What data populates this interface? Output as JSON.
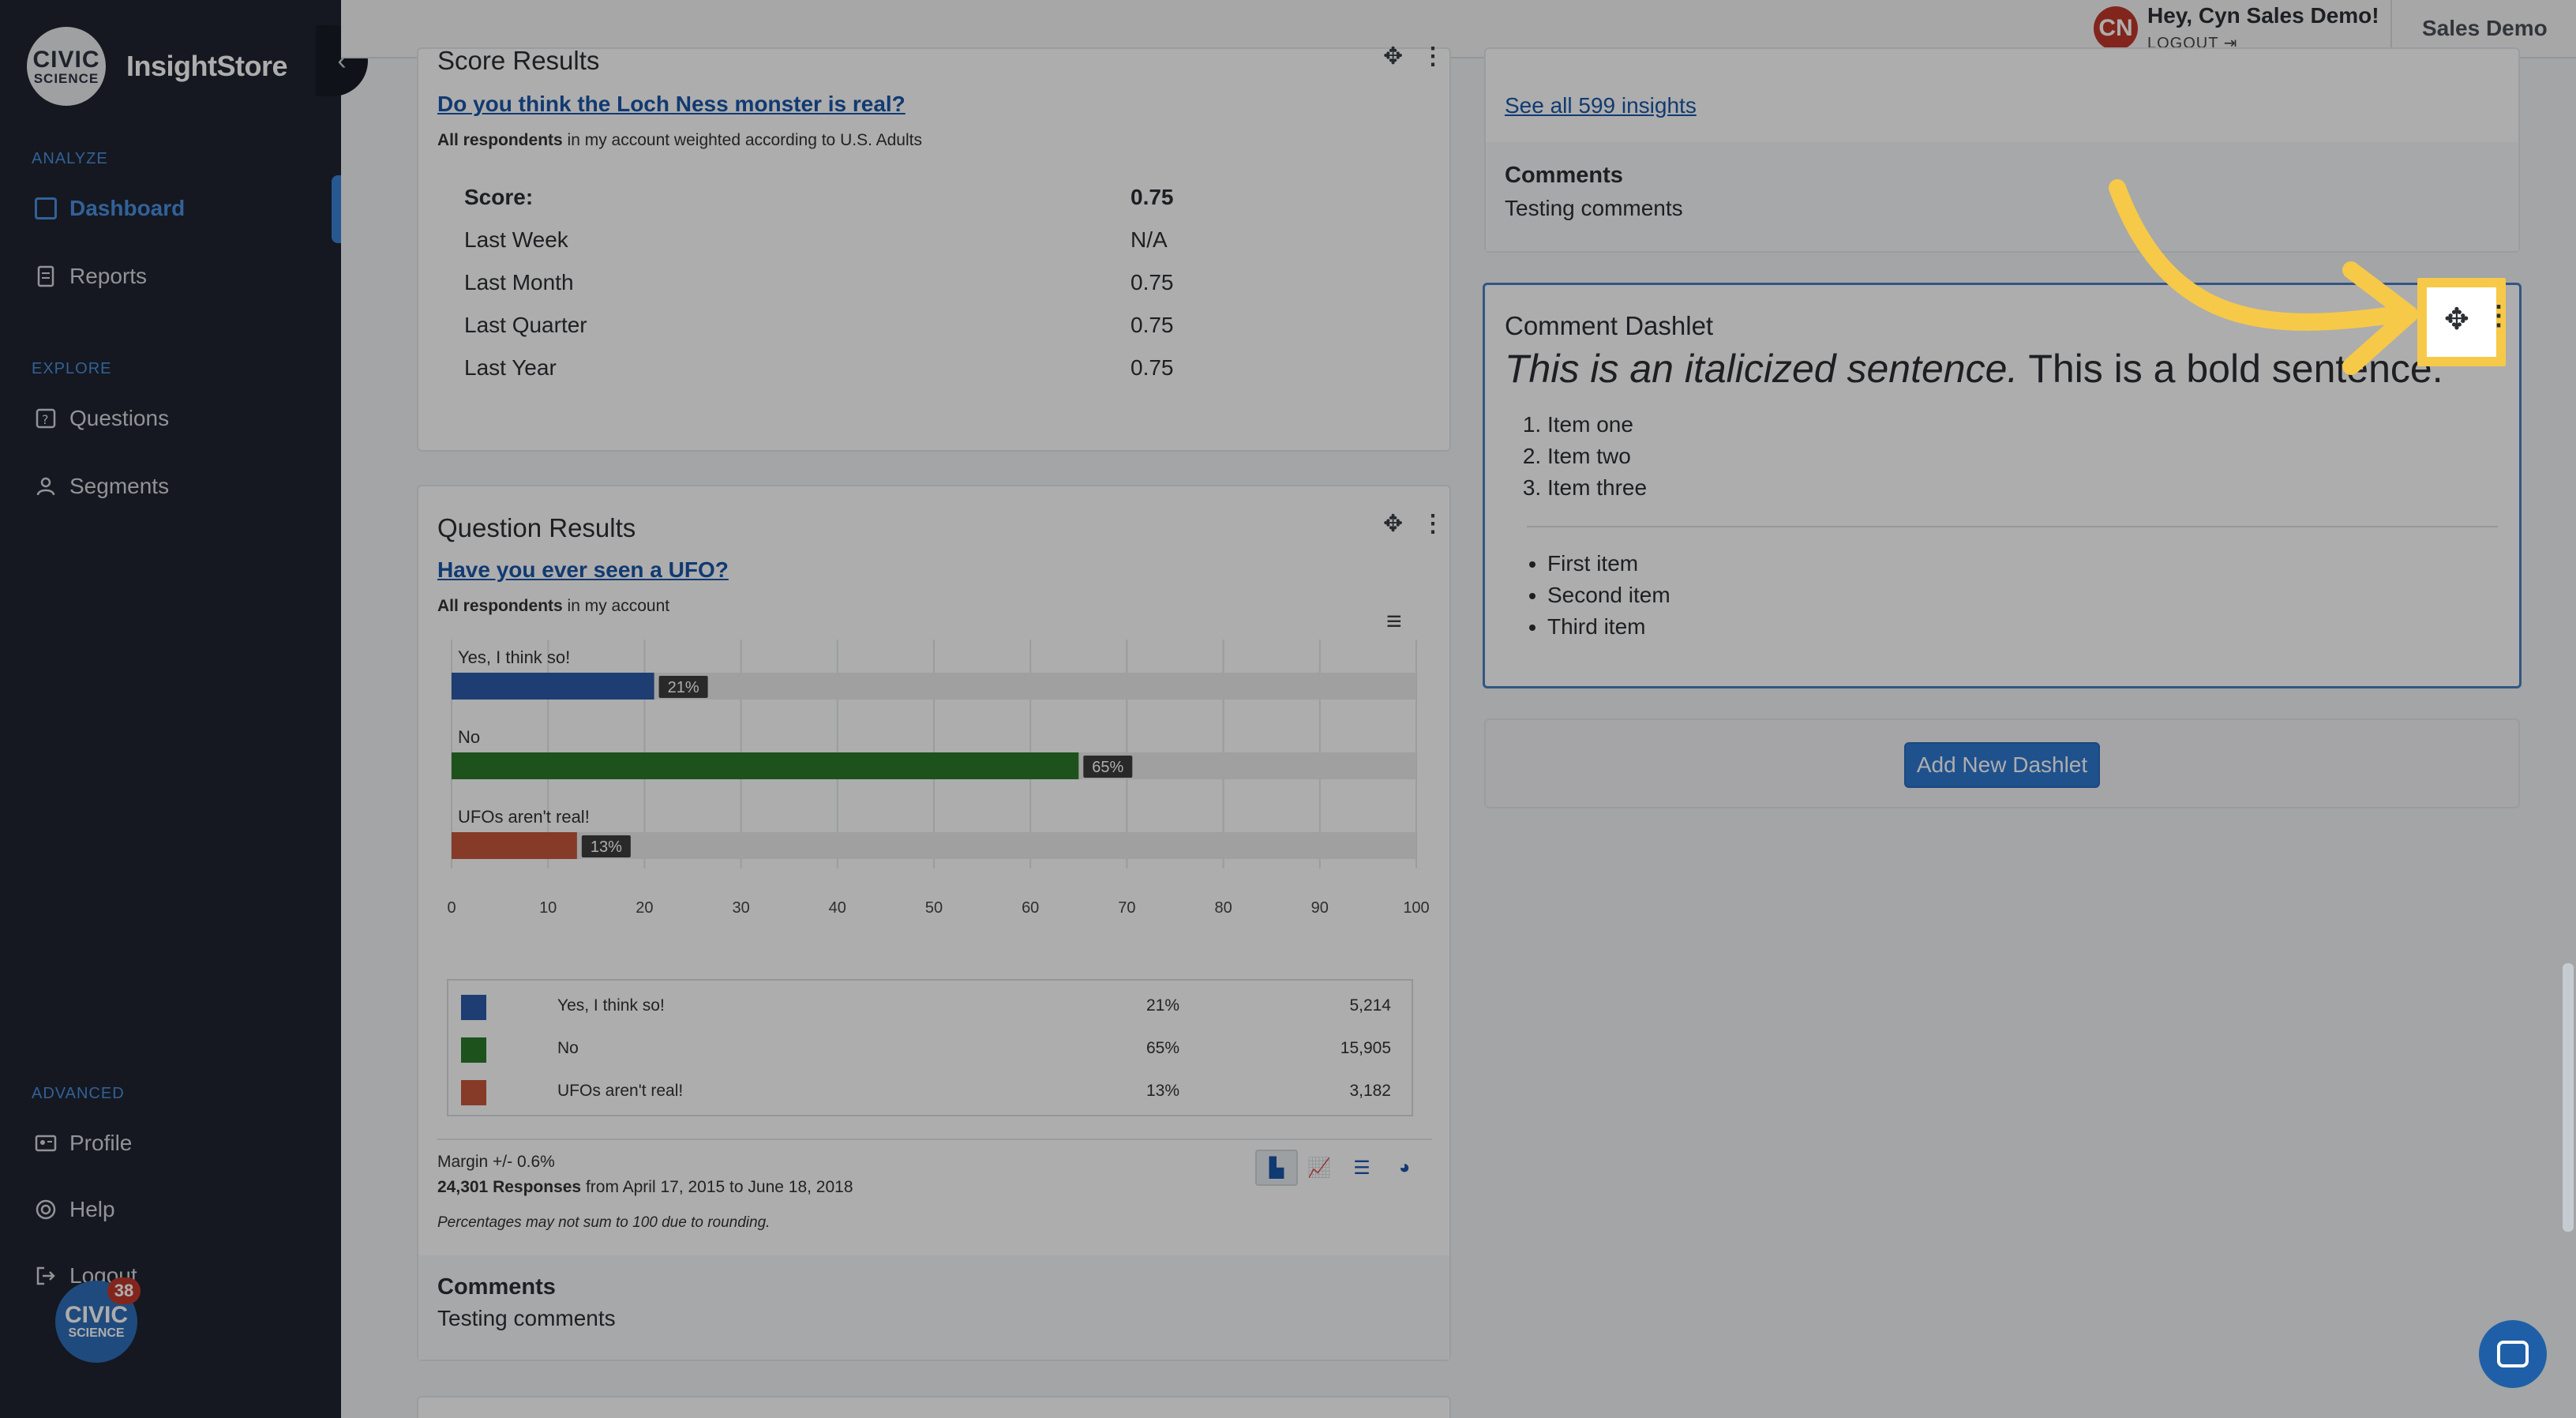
{
  "sidebar": {
    "logo": {
      "line1": "CIVIC",
      "line2": "SCIENCE"
    },
    "brand": "InsightStore",
    "collapse_icon": "chevron-left-icon",
    "sections": {
      "analyze": "ANALYZE",
      "explore": "EXPLORE",
      "advanced": "ADVANCED"
    },
    "items": [
      {
        "label": "Dashboard",
        "icon": "dashboard-icon"
      },
      {
        "label": "Reports",
        "icon": "document-icon"
      },
      {
        "label": "Questions",
        "icon": "question-icon"
      },
      {
        "label": "Segments",
        "icon": "users-icon"
      },
      {
        "label": "Profile",
        "icon": "id-card-icon"
      },
      {
        "label": "Help",
        "icon": "lifebuoy-icon"
      },
      {
        "label": "Logout",
        "icon": "logout-icon"
      }
    ],
    "fab": {
      "line1": "CIVIC",
      "line2": "SCIENCE",
      "badge": "38"
    }
  },
  "topbar": {
    "avatar_initials": "CN",
    "greeting": "Hey, Cyn Sales Demo!",
    "logout": "LOGOUT",
    "org": "Sales Demo"
  },
  "score_card": {
    "title": "Score Results",
    "question": "Do you think the Loch Ness monster is real?",
    "respondents_bold": "All respondents",
    "respondents_rest": " in my account weighted according to U.S. Adults",
    "rows": [
      {
        "label": "Score:",
        "value": "0.75"
      },
      {
        "label": "Last Week",
        "value": "N/A"
      },
      {
        "label": "Last Month",
        "value": "0.75"
      },
      {
        "label": "Last Quarter",
        "value": "0.75"
      },
      {
        "label": "Last Year",
        "value": "0.75"
      }
    ]
  },
  "question_card": {
    "title": "Question Results",
    "question": "Have you ever seen a UFO?",
    "respondents_bold": "All respondents",
    "respondents_rest": " in my account",
    "legend": [
      {
        "label": "Yes, I think so!",
        "pct": "21%",
        "count": "5,214"
      },
      {
        "label": "No",
        "pct": "65%",
        "count": "15,905"
      },
      {
        "label": "UFOs aren't real!",
        "pct": "13%",
        "count": "3,182"
      }
    ],
    "margin": "Margin +/- 0.6%",
    "responses_bold": "24,301 Responses",
    "responses_rest": " from April 17, 2015 to June 18, 2018",
    "note": "Percentages may not sum to 100 due to rounding.",
    "view_icons": [
      "bar-chart-icon",
      "line-chart-icon",
      "stacked-bar-icon",
      "pie-chart-icon"
    ],
    "comments_title": "Comments",
    "comments_text": "Testing comments"
  },
  "chart_data": {
    "type": "bar",
    "orientation": "horizontal",
    "categories": [
      "Yes, I think so!",
      "No",
      "UFOs aren't real!"
    ],
    "values": [
      21,
      65,
      13
    ],
    "data_labels": [
      "21%",
      "65%",
      "13%"
    ],
    "colors": [
      "#2d5aa8",
      "#2b7a2b",
      "#c4573a"
    ],
    "xlim": [
      0,
      100
    ],
    "xticks": [
      0,
      10,
      20,
      30,
      40,
      50,
      60,
      70,
      80,
      90,
      100
    ],
    "grid": true
  },
  "right_col": {
    "insights_link": "See all 599 insights",
    "comments_title": "Comments",
    "comments_text": "Testing comments",
    "dashlet": {
      "title": "Comment Dashlet",
      "italic": "This is an italicized sentence.",
      "bold": " This is a bold sentence.",
      "ordered": [
        "Item one",
        "Item two",
        "Item three"
      ],
      "bullets": [
        "First item",
        "Second item",
        "Third item"
      ]
    },
    "add_button": "Add New Dashlet"
  }
}
